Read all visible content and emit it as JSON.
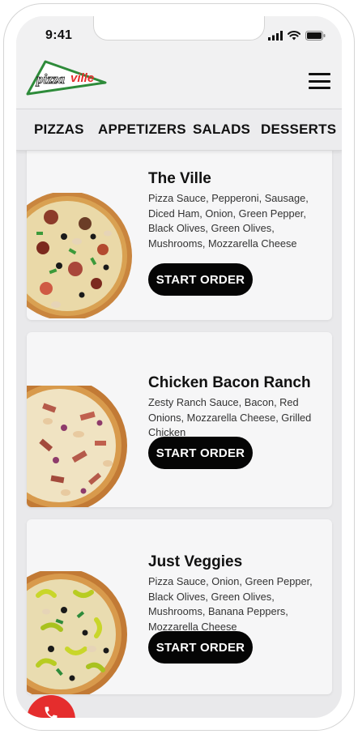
{
  "status_bar": {
    "time": "9:41"
  },
  "header": {
    "logo_text": {
      "part1": "pizza",
      "part2": "ville"
    }
  },
  "nav": {
    "items": [
      "PIZZAS",
      "APPETIZERS",
      "SALADS",
      "DESSERTS"
    ]
  },
  "menu_items": [
    {
      "title": "The Ville",
      "description": "Pizza Sauce, Pepperoni, Sausage, Diced Ham, Onion, Green Pepper, Black Olives, Green Olives, Mushrooms, Mozzarella Cheese",
      "button_label": "START ORDER"
    },
    {
      "title": "Chicken Bacon Ranch",
      "description": "Zesty Ranch Sauce, Bacon, Red Onions, Mozzarella Cheese, Grilled Chicken",
      "button_label": "START ORDER"
    },
    {
      "title": "Just Veggies",
      "description": "Pizza Sauce, Onion, Green Pepper, Black Olives, Green Olives, Mushrooms, Banana Peppers, Mozzarella Cheese",
      "button_label": "START ORDER"
    }
  ],
  "colors": {
    "accent_red": "#e52d2d",
    "logo_green": "#2e8b3a",
    "button_black": "#050505"
  },
  "icons": [
    "signal-icon",
    "wifi-icon",
    "battery-icon",
    "hamburger-menu-icon",
    "phone-icon"
  ]
}
